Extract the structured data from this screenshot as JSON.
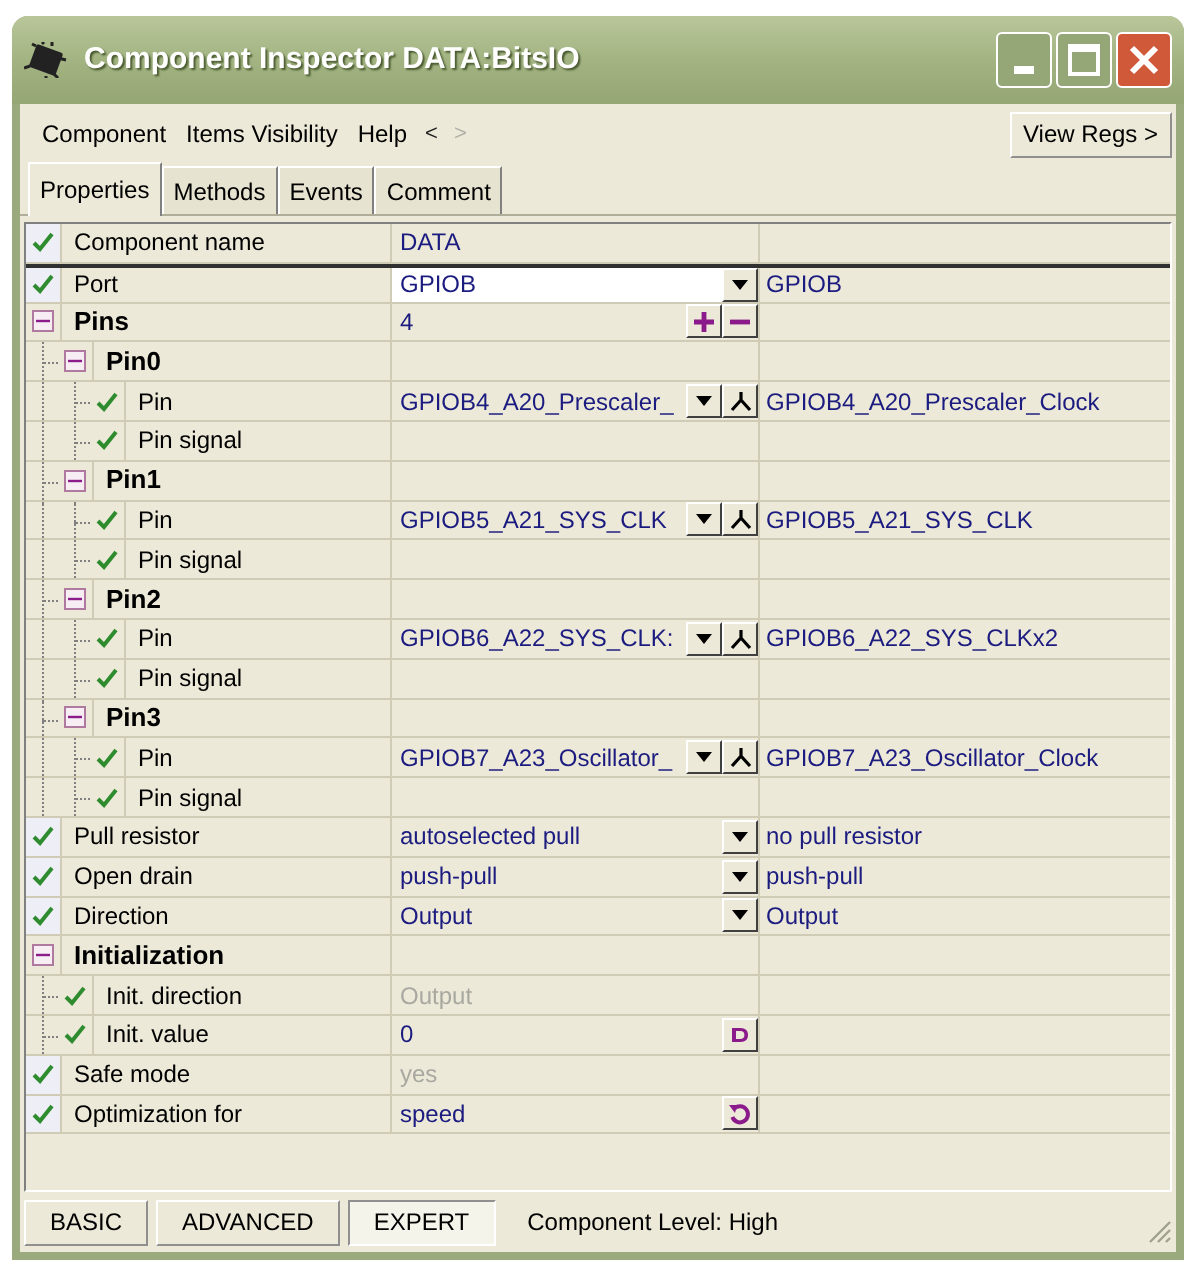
{
  "window": {
    "title": "Component Inspector DATA:BitsIO"
  },
  "menu": [
    {
      "label": "Component",
      "kind": "menu"
    },
    {
      "label": "Items Visibility",
      "kind": "menu"
    },
    {
      "label": "Help",
      "kind": "menu"
    },
    {
      "label": "<",
      "kind": "nav",
      "disabled": false
    },
    {
      "label": ">",
      "kind": "nav",
      "disabled": true
    }
  ],
  "view_regs_button": "View Regs >",
  "tabs": [
    {
      "label": "Properties",
      "selected": true
    },
    {
      "label": "Methods",
      "selected": false
    },
    {
      "label": "Events",
      "selected": false
    },
    {
      "label": "Comment",
      "selected": false
    }
  ],
  "rows": [
    {
      "kind": "property",
      "name": "Component name",
      "checked": true,
      "selected": false,
      "value": "DATA",
      "disabled": false
    },
    {
      "kind": "property",
      "name": "Port",
      "checked": true,
      "selected": true,
      "value": "GPIOB",
      "disabled": false,
      "buttons": [
        {
          "kind": "dropdown"
        }
      ],
      "current": "GPIOB"
    },
    {
      "kind": "group",
      "name": "Pins",
      "expanded": true,
      "selected": false,
      "value": "4",
      "buttons": [
        {
          "kind": "add"
        },
        {
          "kind": "remove"
        }
      ],
      "children": [
        {
          "kind": "group",
          "name": "Pin0",
          "expanded": true,
          "selected": false,
          "children": [
            {
              "kind": "property",
              "name": "Pin",
              "checked": true,
              "selected": false,
              "value": "GPIOB4_A20_Prescaler_",
              "disabled": false,
              "buttons": [
                {
                  "kind": "dropdown"
                },
                {
                  "kind": "pin"
                }
              ],
              "current": "GPIOB4_A20_Prescaler_Clock"
            },
            {
              "kind": "property",
              "name": "Pin signal",
              "checked": true,
              "selected": false
            }
          ]
        },
        {
          "kind": "group",
          "name": "Pin1",
          "expanded": true,
          "selected": false,
          "children": [
            {
              "kind": "property",
              "name": "Pin",
              "checked": true,
              "selected": false,
              "value": "GPIOB5_A21_SYS_CLK",
              "disabled": false,
              "buttons": [
                {
                  "kind": "dropdown"
                },
                {
                  "kind": "pin"
                }
              ],
              "current": "GPIOB5_A21_SYS_CLK"
            },
            {
              "kind": "property",
              "name": "Pin signal",
              "checked": true,
              "selected": false
            }
          ]
        },
        {
          "kind": "group",
          "name": "Pin2",
          "expanded": true,
          "selected": false,
          "children": [
            {
              "kind": "property",
              "name": "Pin",
              "checked": true,
              "selected": false,
              "value": "GPIOB6_A22_SYS_CLK:",
              "disabled": false,
              "buttons": [
                {
                  "kind": "dropdown"
                },
                {
                  "kind": "pin"
                }
              ],
              "current": "GPIOB6_A22_SYS_CLKx2"
            },
            {
              "kind": "property",
              "name": "Pin signal",
              "checked": true,
              "selected": false
            }
          ]
        },
        {
          "kind": "group",
          "name": "Pin3",
          "expanded": true,
          "selected": false,
          "children": [
            {
              "kind": "property",
              "name": "Pin",
              "checked": true,
              "selected": false,
              "value": "GPIOB7_A23_Oscillator_",
              "disabled": false,
              "buttons": [
                {
                  "kind": "dropdown"
                },
                {
                  "kind": "pin"
                }
              ],
              "current": "GPIOB7_A23_Oscillator_Clock"
            },
            {
              "kind": "property",
              "name": "Pin signal",
              "checked": true,
              "selected": false
            }
          ]
        }
      ]
    },
    {
      "kind": "property",
      "name": "Pull resistor",
      "checked": true,
      "selected": false,
      "value": "autoselected pull",
      "disabled": false,
      "buttons": [
        {
          "kind": "dropdown"
        }
      ],
      "current": "no pull resistor"
    },
    {
      "kind": "property",
      "name": "Open drain",
      "checked": true,
      "selected": false,
      "value": "push-pull",
      "disabled": false,
      "buttons": [
        {
          "kind": "dropdown"
        }
      ],
      "current": "push-pull"
    },
    {
      "kind": "property",
      "name": "Direction",
      "checked": true,
      "selected": false,
      "value": "Output",
      "disabled": false,
      "buttons": [
        {
          "kind": "dropdown"
        }
      ],
      "current": "Output"
    },
    {
      "kind": "group",
      "name": "Initialization",
      "expanded": true,
      "selected": false,
      "children": [
        {
          "kind": "property",
          "name": "Init. direction",
          "checked": true,
          "selected": false,
          "value": "Output",
          "disabled": true
        },
        {
          "kind": "property",
          "name": "Init. value",
          "checked": true,
          "selected": false,
          "value": "0",
          "disabled": false,
          "buttons": [
            {
              "kind": "dialog"
            }
          ]
        }
      ]
    },
    {
      "kind": "property",
      "name": "Safe mode",
      "checked": true,
      "selected": false,
      "value": "yes",
      "disabled": true
    },
    {
      "kind": "property",
      "name": "Optimization for",
      "checked": true,
      "selected": false,
      "value": "speed",
      "disabled": false,
      "buttons": [
        {
          "kind": "reset"
        }
      ]
    }
  ],
  "levels": [
    {
      "label": "BASIC",
      "selected": false
    },
    {
      "label": "ADVANCED",
      "selected": false
    },
    {
      "label": "EXPERT",
      "selected": true
    }
  ],
  "status": "Component Level: High"
}
